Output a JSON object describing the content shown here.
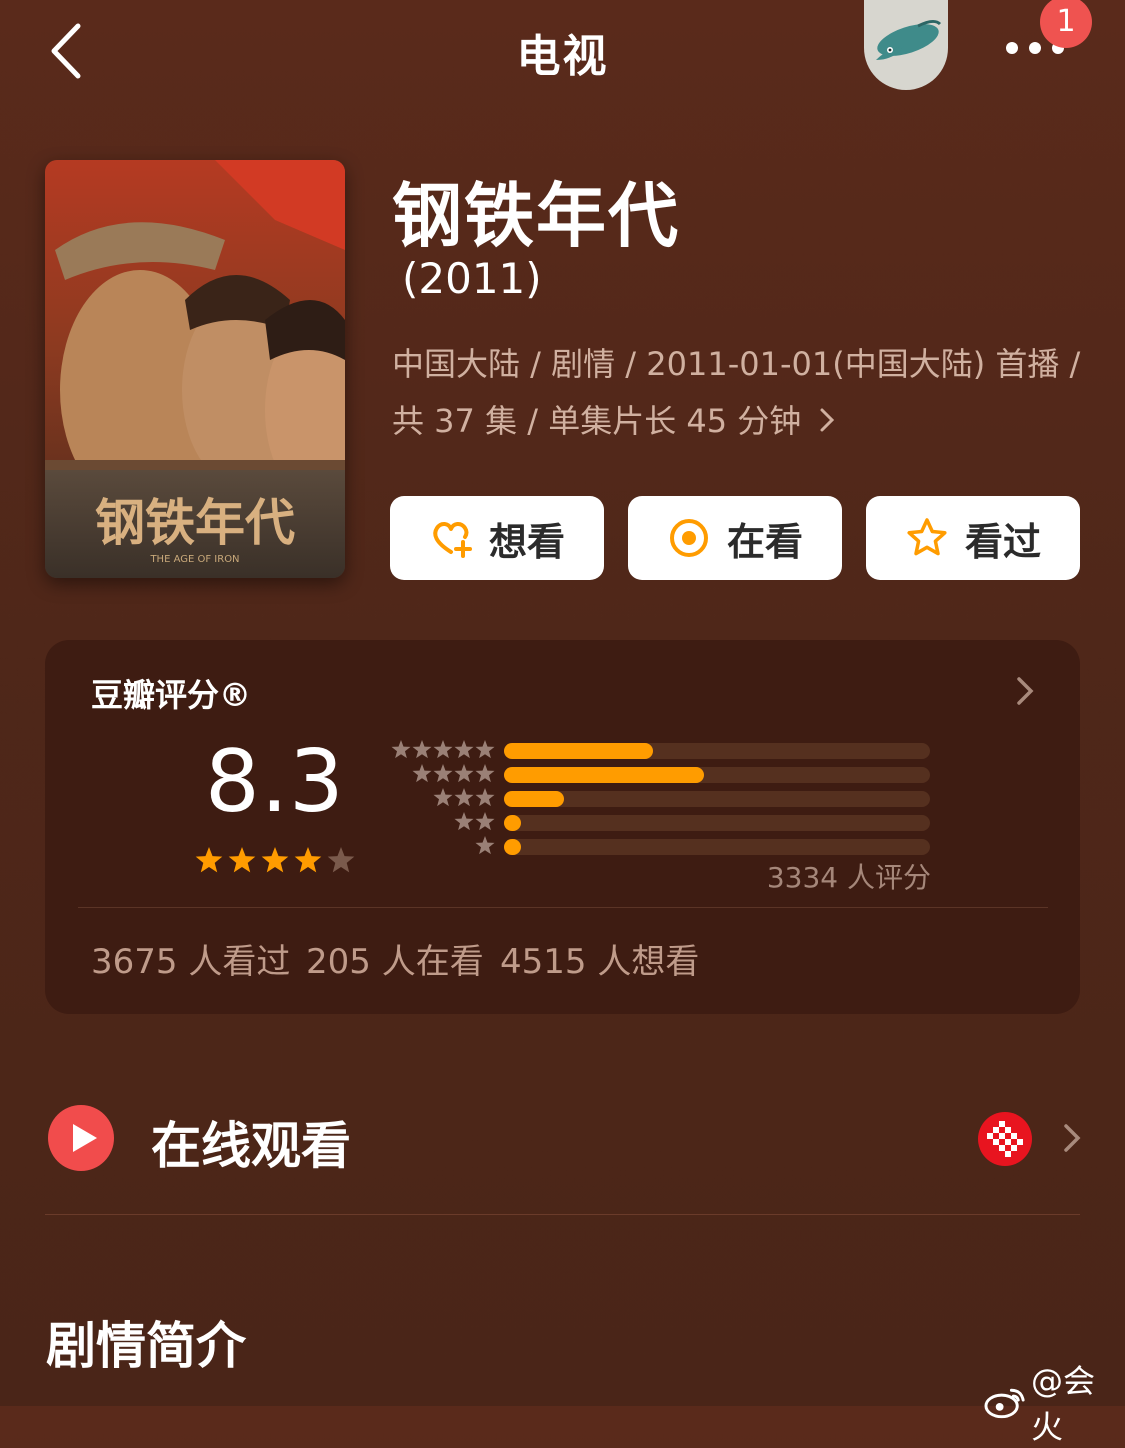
{
  "nav": {
    "title": "电视",
    "notification_count": "1"
  },
  "movie": {
    "title": "钢铁年代",
    "year": "(2011)",
    "meta_line1": "中国大陆 / 剧情 / 2011-01-01(中国大陆) 首播 /",
    "meta_line2": "共 37 集 / 单集片长 45 分钟",
    "poster_title": "钢铁年代",
    "poster_subtitle": "THE AGE OF IRON"
  },
  "actions": {
    "want": "想看",
    "watching": "在看",
    "watched": "看过"
  },
  "rating": {
    "label": "豆瓣评分®",
    "score": "8.3",
    "score_stars": 4,
    "distribution": [
      {
        "stars": 5,
        "fraction": 0.35
      },
      {
        "stars": 4,
        "fraction": 0.47
      },
      {
        "stars": 3,
        "fraction": 0.14
      },
      {
        "stars": 2,
        "fraction": 0.04
      },
      {
        "stars": 1,
        "fraction": 0.04
      }
    ],
    "total": "3334 人评分",
    "watched_count": "3675 人看过",
    "watching_count": "205 人在看",
    "want_count": "4515 人想看"
  },
  "online": {
    "label": "在线观看"
  },
  "synopsis": {
    "label": "剧情简介"
  },
  "watermark": {
    "text": "@会火"
  },
  "colors": {
    "accent": "#ff9c00",
    "badge": "#ef5350",
    "play": "#f14c4c",
    "card": "#3e1c12"
  }
}
